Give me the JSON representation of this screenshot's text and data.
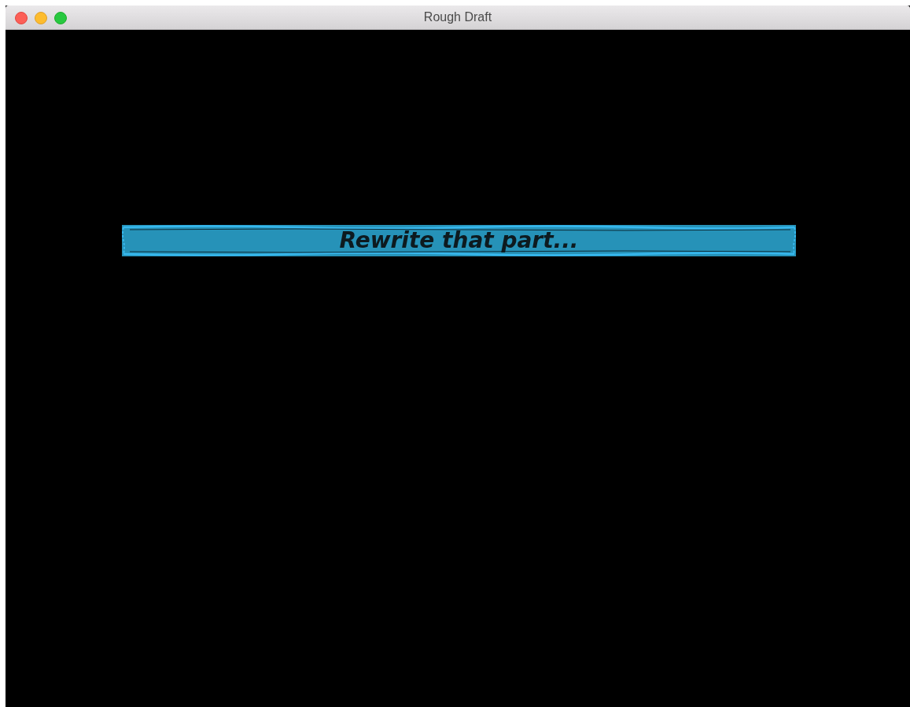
{
  "window": {
    "title": "Rough Draft"
  },
  "banner": {
    "text": "Rewrite that part..."
  }
}
